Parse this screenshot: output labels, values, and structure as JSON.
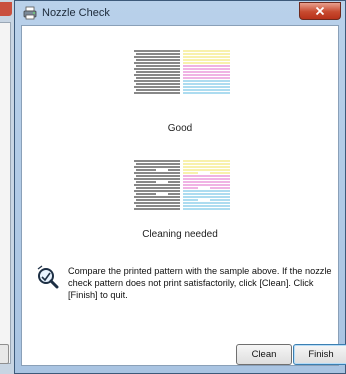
{
  "window": {
    "title": "Nozzle Check",
    "icon": "printer-icon"
  },
  "samples": [
    {
      "label": "Good"
    },
    {
      "label": "Cleaning needed"
    }
  ],
  "instruction": "Compare the printed pattern with the sample above. If the nozzle check pattern does not print satisfactorily, click [Clean]. Click [Finish] to quit.",
  "buttons": {
    "clean": "Clean",
    "finish": "Finish"
  },
  "colors": {
    "black": "#111111",
    "cyan": "#5bb8e0",
    "magenta": "#e067c8",
    "yellow": "#f1e35a",
    "close": "#c74a2f"
  }
}
